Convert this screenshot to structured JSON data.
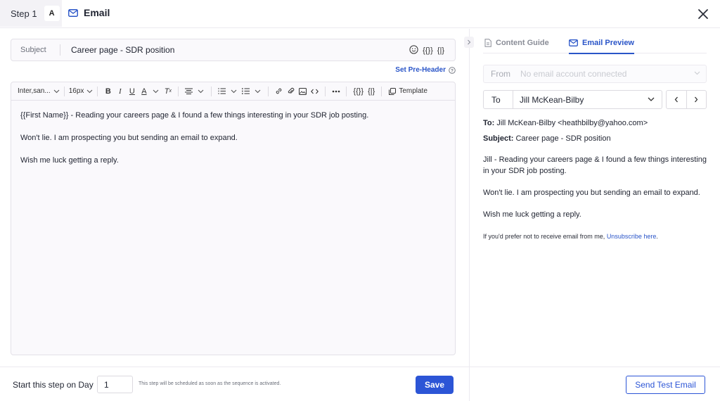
{
  "header": {
    "step_label": "Step 1",
    "variant": "A",
    "step_type": "Email",
    "close_icon": "close-icon"
  },
  "subject": {
    "label": "Subject",
    "value": "Career page - SDR position",
    "tools": [
      "emoji-icon",
      "{{}}",
      "{|}"
    ]
  },
  "set_preheader": "Set Pre-Header",
  "toolbar": {
    "font_family": "Inter,san...",
    "font_size": "16px",
    "variable_tag": "{{}}",
    "snippet_tag": "{|}",
    "template_label": "Template"
  },
  "editor": {
    "paragraphs": [
      "{{First Name}} - Reading your careers page & I found a few things interesting in your SDR job posting.",
      "Won't lie. I am prospecting you but sending an email to expand.",
      "Wish me luck getting a reply."
    ]
  },
  "footer": {
    "start_label": "Start this step on Day",
    "day_value": "1",
    "schedule_hint": "This step will be scheduled as soon as the sequence is activated.",
    "save_label": "Save",
    "test_label": "Send Test Email"
  },
  "tabs": {
    "content_guide": "Content Guide",
    "email_preview": "Email Preview",
    "active": "email_preview"
  },
  "preview": {
    "from_label": "From",
    "from_placeholder": "No email account connected",
    "to_label": "To",
    "to_value": "Jill McKean-Bilby",
    "to_line_label": "To:",
    "to_line_value": "Jill McKean-Bilby <heathbilby@yahoo.com>",
    "subject_line_label": "Subject:",
    "subject_line_value": "Career page - SDR position",
    "body": [
      "Jill - Reading your careers page & I found a few things interesting in your SDR job posting.",
      "Won't lie. I am prospecting you but sending an email to expand.",
      "Wish me luck getting a reply."
    ],
    "unsubscribe_prefix": "If you'd prefer not to receive email from me,",
    "unsubscribe_link": "Unsubscribe here",
    "unsubscribe_suffix": "."
  },
  "colors": {
    "accent": "#2c55d6",
    "link": "#2a55c8"
  }
}
